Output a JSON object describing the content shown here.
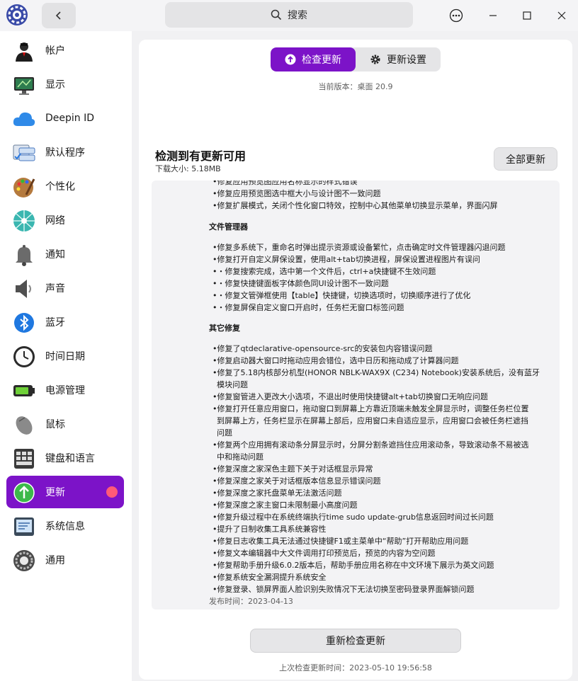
{
  "titlebar": {
    "search_placeholder": "搜索"
  },
  "sidebar": {
    "items": [
      {
        "label": "帐户"
      },
      {
        "label": "显示"
      },
      {
        "label": "Deepin ID"
      },
      {
        "label": "默认程序"
      },
      {
        "label": "个性化"
      },
      {
        "label": "网络"
      },
      {
        "label": "通知"
      },
      {
        "label": "声音"
      },
      {
        "label": "蓝牙"
      },
      {
        "label": "时间日期"
      },
      {
        "label": "电源管理"
      },
      {
        "label": "鼠标"
      },
      {
        "label": "键盘和语言"
      },
      {
        "label": "更新"
      },
      {
        "label": "系统信息"
      },
      {
        "label": "通用"
      }
    ],
    "active_index": 13
  },
  "main": {
    "tabs": [
      {
        "label": "检查更新"
      },
      {
        "label": "更新设置"
      }
    ],
    "current_version": "当前版本：桌面 20.9",
    "found_title": "检测到有更新可用",
    "download_size": "下载大小: 5.18MB",
    "update_all": "全部更新",
    "notes": {
      "lines": [
        "•修复应用预览图应用名称显示的样式错误",
        "•修复应用预览图选中框大小与设计图不一致问题",
        "•修复扩展模式，关闭个性化窗口特效，控制中心其他菜单切换显示菜单，界面闪屏"
      ],
      "file_manager_heading": "文件管理器",
      "file_manager": [
        "•修复多系统下，重命名时弹出提示资源或设备繁忙，点击确定时文件管理器闪退问题",
        "•修复打开自定义屏保设置，使用alt+tab切换进程，屏保设置进程图片有误问",
        "•・修复搜索完成，选中第一个文件后，ctrl+a快捷键不生效问题",
        "•・修复快捷键面板字体颜色同UI设计图不一致问题",
        "•・修复文管弹框使用【table】快捷键，切换选项时，切换顺序进行了优化",
        "•・修复屏保自定义窗口开启时，任务栏无窗口标签问题"
      ],
      "other_heading": "其它修复",
      "other": [
        "•修复了qtdeclarative-opensource-src的安装包内容错误问题",
        "•修复启动器大窗口时拖动应用会错位，选中日历和拖动成了计算器问题",
        "•修复了5.18内核部分机型(HONOR NBLK-WAX9X (C234) Notebook)安装系统后，没有蓝牙",
        "模块问题",
        "•修复窗管进入更改大小选项，不退出时使用快捷键alt+tab切换窗口无响应问题",
        "•修复打开任意应用窗口，拖动窗口到屏幕上方靠近顶端未触发全屏显示时，调整任务栏位置",
        "到屏幕上方，任务栏显示在屏幕上部后，应用窗口未自适应显示，应用窗口会被任务栏遮挡",
        "问题",
        "•修复两个应用拥有滚动条分屏显示时，分屏分割条遮挡住应用滚动条，导致滚动条不易被选",
        "中和拖动问题",
        "•修复深度之家深色主题下关于对话框显示异常",
        "•修复深度之家关于对话框版本信息显示错误问题",
        "•修复深度之家托盘菜单无法激活问题",
        "•修复深度之家主窗口未限制最小高度问题",
        "•修复升级过程中在系统终端执行time sudo update-grub信息返回时间过长问题",
        "•提升了日制收集工具系统兼容性",
        "•修复日志收集工具无法通过快捷键F1或主菜单中“帮助”打开帮助应用问题",
        "•修复文本编辑器中大文件调用打印预览后，预览的内容为空问题",
        "•修复帮助手册升级6.0.2版本后，帮助手册应用名称在中文环境下展示为英文问题",
        "•修复系统安全漏洞提升系统安全",
        "•修复登录、锁屏界面人脸识别失败情况下无法切换至密码登录界面解锁问题"
      ],
      "published": "发布时间：2023-04-13"
    },
    "recheck": "重新检查更新",
    "last_check": "上次检查更新时间：2023-05-10 19:56:58"
  },
  "colors": {
    "accent": "#7c13c8",
    "badge": "#ff5a78"
  }
}
